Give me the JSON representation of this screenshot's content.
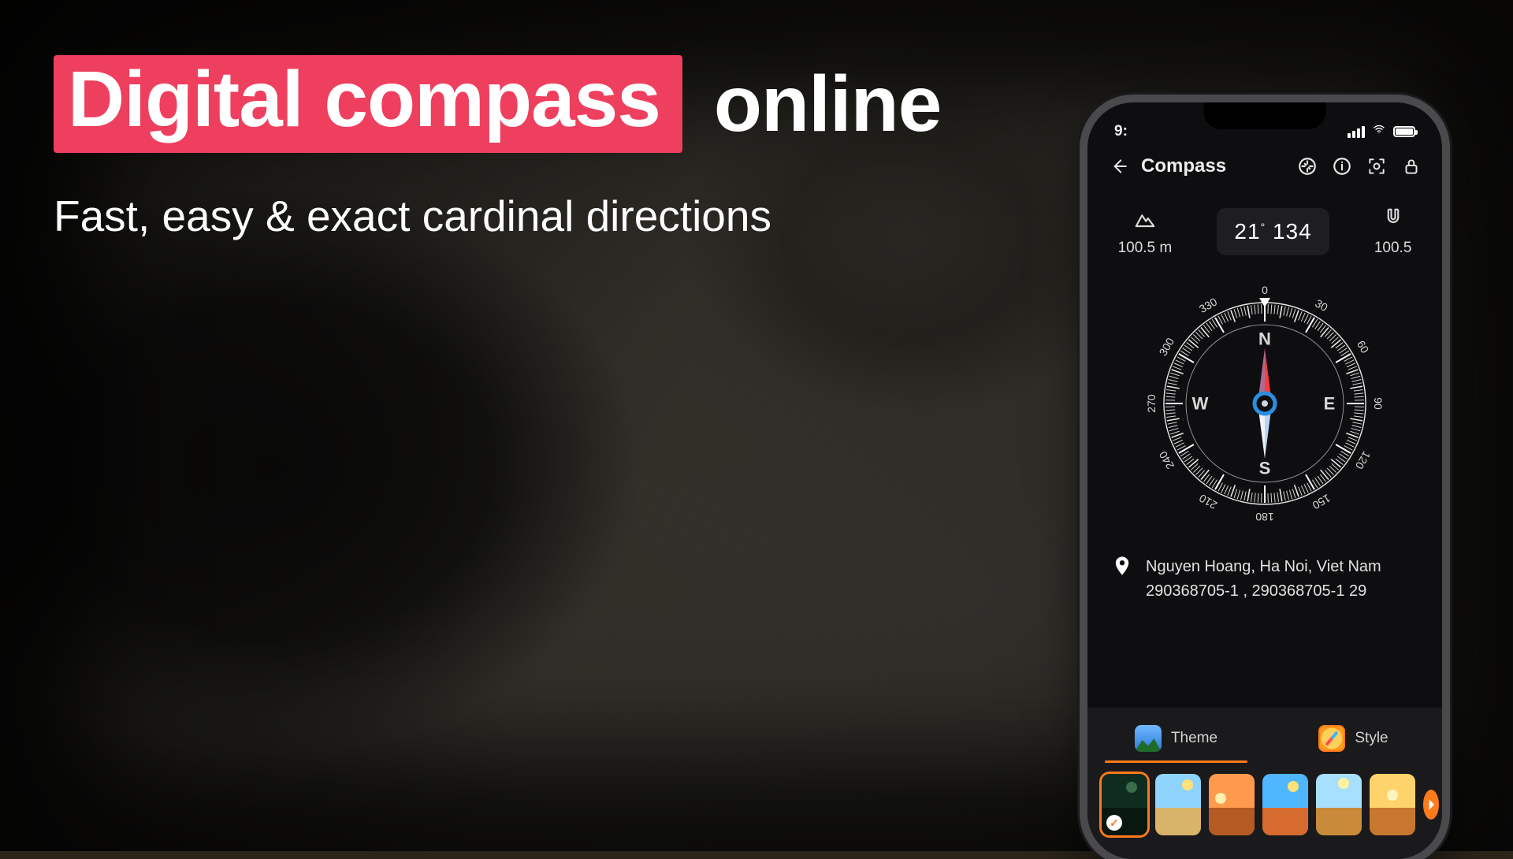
{
  "hero": {
    "highlight": "Digital compass",
    "tail": "online",
    "subtitle": "Fast, easy & exact cardinal directions"
  },
  "phone": {
    "status": {
      "time": "9:"
    },
    "title": "Compass",
    "readings": {
      "altitude_value": "100.5 m",
      "heading_degrees": "21",
      "heading_value": "134",
      "magnet_value": "100.5"
    },
    "compass": {
      "labels": {
        "n": "N",
        "e": "E",
        "s": "S",
        "w": "W"
      },
      "ticks": [
        "0",
        "30",
        "60",
        "90",
        "120",
        "150",
        "180",
        "210",
        "240",
        "270",
        "300",
        "330"
      ]
    },
    "location": {
      "address": "Nguyen Hoang, Ha Noi, Viet Nam",
      "coords": "290368705-1 ,  290368705-1   29"
    },
    "tabs": {
      "theme": "Theme",
      "style": "Style"
    },
    "themes": [
      {
        "sky": "#0f2d1f",
        "gnd": "#08170f",
        "sun": "#3a6d4a",
        "sunpos": "65% 22%",
        "selected": true
      },
      {
        "sky": "#8fd3ff",
        "gnd": "#d8b46a",
        "sun": "#ffe27a",
        "sunpos": "70% 18%"
      },
      {
        "sky": "#ff9a4d",
        "gnd": "#b55a22",
        "sun": "#ffefb0",
        "sunpos": "25% 40%"
      },
      {
        "sky": "#4fb7ff",
        "gnd": "#d66b2f",
        "sun": "#ffe27a",
        "sunpos": "68% 20%"
      },
      {
        "sky": "#a7e0ff",
        "gnd": "#c98b3a",
        "sun": "#fff2a0",
        "sunpos": "60% 15%"
      },
      {
        "sky": "#ffd36b",
        "gnd": "#c7782e",
        "sun": "#fff5c0",
        "sunpos": "50% 35%"
      }
    ]
  },
  "colors": {
    "accent": "#ef3f5f",
    "orange": "#ff7a1a"
  }
}
